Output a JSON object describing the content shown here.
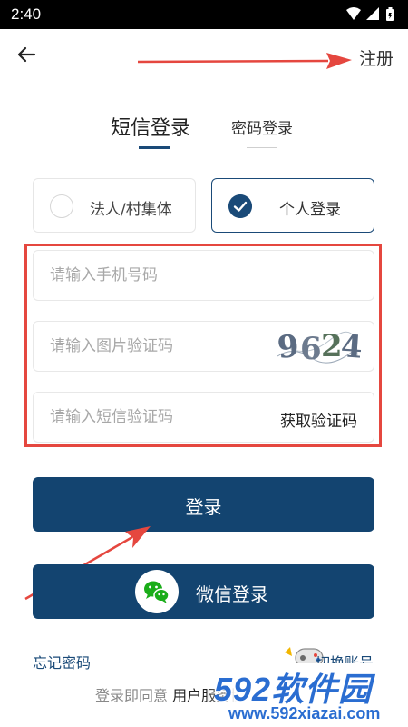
{
  "status_bar": {
    "time": "2:40"
  },
  "nav": {
    "register_label": "注册"
  },
  "tabs": [
    {
      "label": "短信登录",
      "active": true
    },
    {
      "label": "密码登录",
      "active": false
    }
  ],
  "login_types": [
    {
      "label": "法人/村集体",
      "selected": false
    },
    {
      "label": "个人登录",
      "selected": true
    }
  ],
  "form": {
    "phone_placeholder": "请输入手机号码",
    "captcha_placeholder": "请输入图片验证码",
    "captcha_text": [
      "9",
      "6",
      "2",
      "4"
    ],
    "sms_placeholder": "请输入短信验证码",
    "get_code_label": "获取验证码"
  },
  "buttons": {
    "login": "登录",
    "wechat_login": "微信登录"
  },
  "footer": {
    "forgot_password": "忘记密码",
    "switch_account": "切换账号",
    "agreement_prefix": "登录即同意",
    "agreement_link": "用户服务协议"
  },
  "watermark": {
    "logo": "592软件园",
    "url": "www.592xiazai.com"
  },
  "colors": {
    "primary": "#134470",
    "annotation": "#e5473f",
    "wechat": "#1aad19"
  }
}
